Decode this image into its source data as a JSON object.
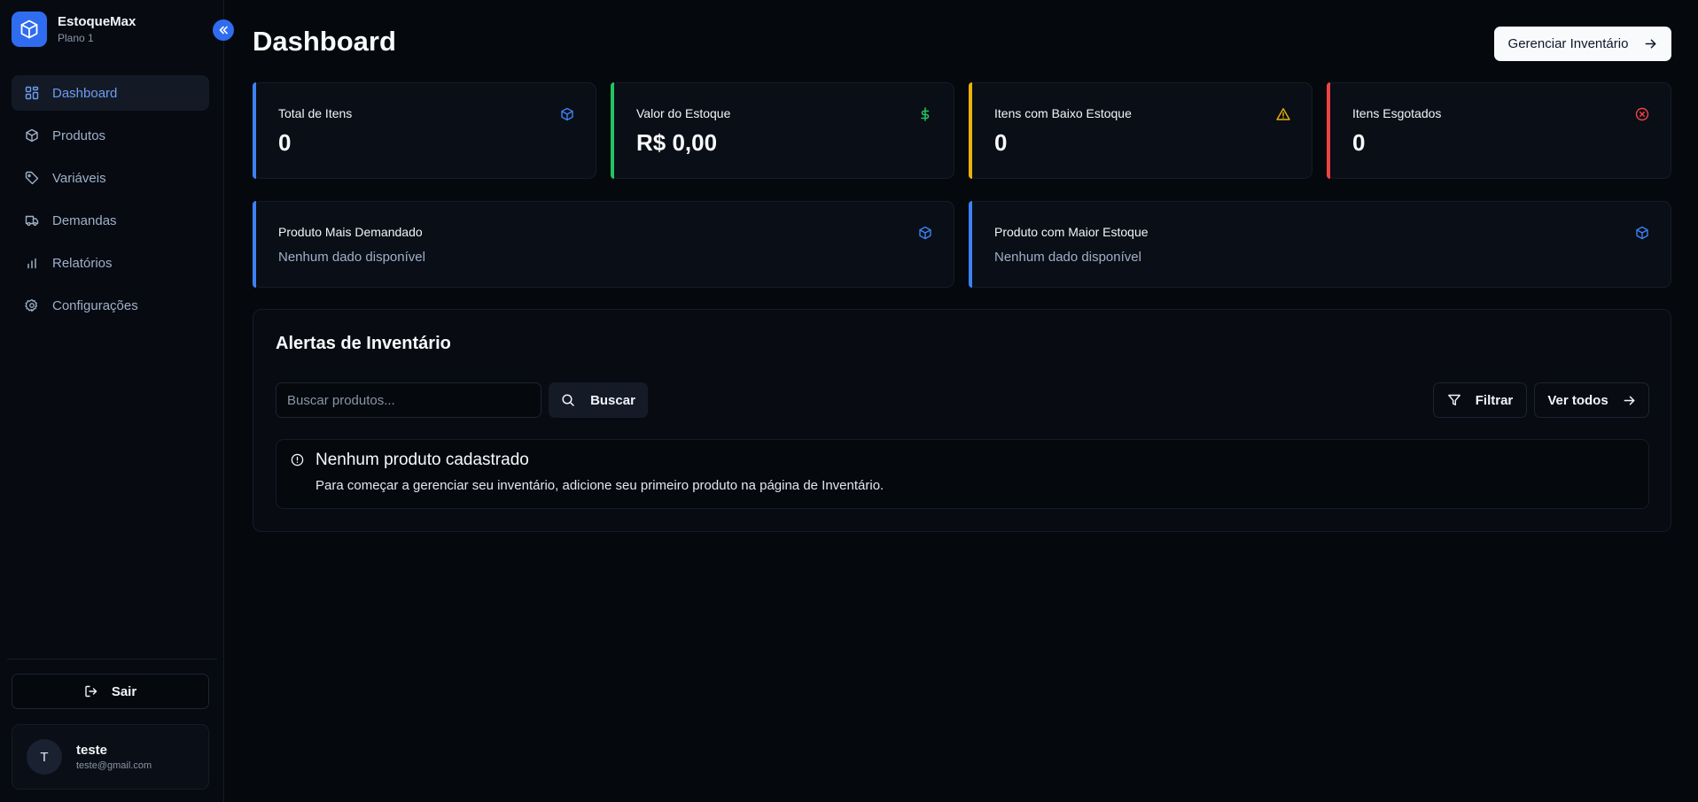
{
  "brand": {
    "name": "EstoqueMax",
    "plan": "Plano 1"
  },
  "sidebar": {
    "items": [
      {
        "label": "Dashboard",
        "icon": "dashboard-icon",
        "active": true
      },
      {
        "label": "Produtos",
        "icon": "package-icon"
      },
      {
        "label": "Variáveis",
        "icon": "tag-icon"
      },
      {
        "label": "Demandas",
        "icon": "truck-icon"
      },
      {
        "label": "Relatórios",
        "icon": "bar-chart-icon"
      },
      {
        "label": "Configurações",
        "icon": "gear-icon"
      }
    ],
    "logout_label": "Sair",
    "user": {
      "initial": "T",
      "name": "teste",
      "email": "teste@gmail.com"
    }
  },
  "header": {
    "title": "Dashboard",
    "manage_button": "Gerenciar Inventário"
  },
  "stats": [
    {
      "label": "Total de Itens",
      "value": "0",
      "color": "#3b82f6",
      "icon": "package-icon"
    },
    {
      "label": "Valor do Estoque",
      "value": "R$ 0,00",
      "color": "#22c55e",
      "icon": "dollar-icon"
    },
    {
      "label": "Itens com Baixo Estoque",
      "value": "0",
      "color": "#eab308",
      "icon": "warning-icon"
    },
    {
      "label": "Itens Esgotados",
      "value": "0",
      "color": "#ef4444",
      "icon": "x-circle-icon"
    }
  ],
  "highlights": [
    {
      "label": "Produto Mais Demandado",
      "value": "Nenhum dado disponível",
      "color": "#3b82f6"
    },
    {
      "label": "Produto com Maior Estoque",
      "value": "Nenhum dado disponível",
      "color": "#3b82f6"
    }
  ],
  "alerts": {
    "title": "Alertas de Inventário",
    "search_placeholder": "Buscar produtos...",
    "search_button": "Buscar",
    "filter_button": "Filtrar",
    "view_all_button": "Ver todos",
    "empty_title": "Nenhum produto cadastrado",
    "empty_description": "Para começar a gerenciar seu inventário, adicione seu primeiro produto na página de Inventário."
  }
}
